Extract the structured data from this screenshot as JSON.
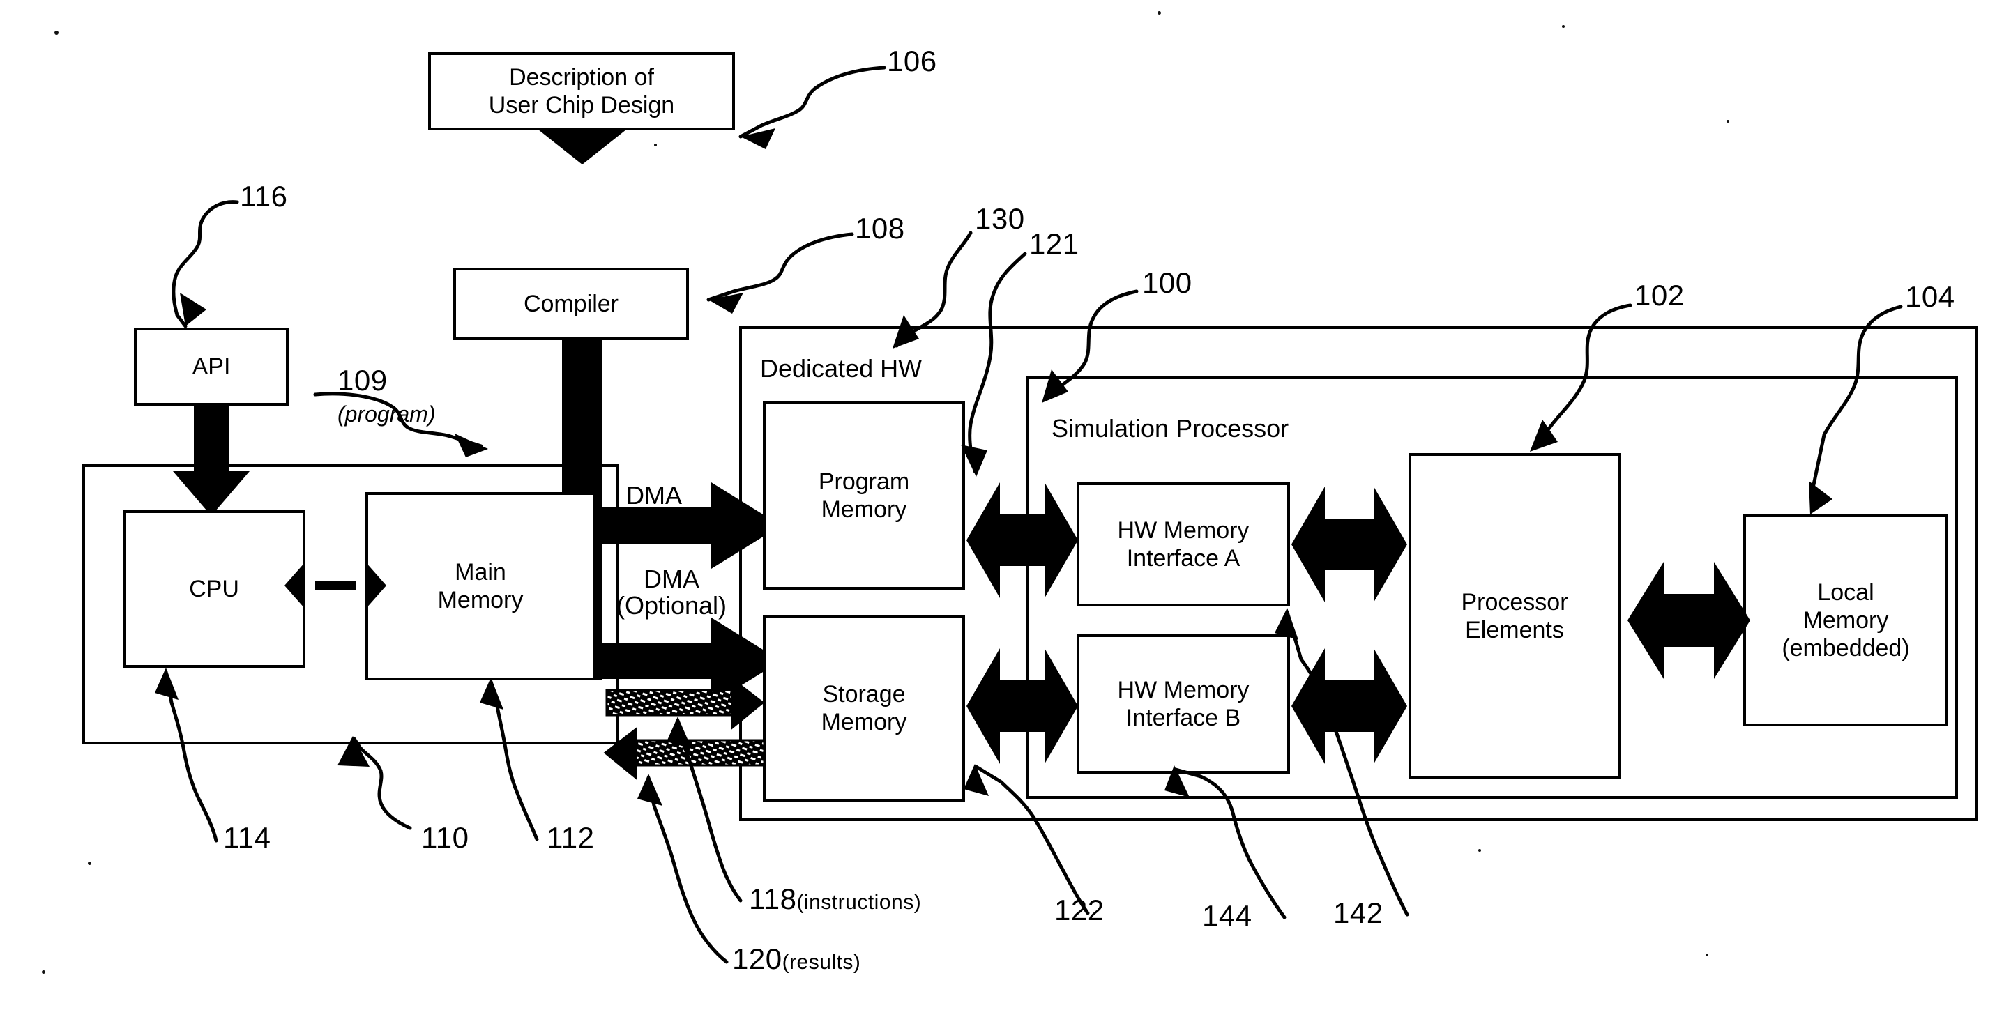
{
  "figure": {
    "title": "Simulation Processor System Block Diagram",
    "style": "patent-line-drawing",
    "ink_color": "#000000",
    "paper_color": "#ffffff"
  },
  "blocks": {
    "description": "Description of\nUser Chip Design",
    "description_line1": "Description of",
    "description_line2": "User Chip Design",
    "compiler": "Compiler",
    "api": "API",
    "cpu": "CPU",
    "main_memory_line1": "Main",
    "main_memory_line2": "Memory",
    "program_memory_line1": "Program",
    "program_memory_line2": "Memory",
    "storage_memory_line1": "Storage",
    "storage_memory_line2": "Memory",
    "hw_mem_a_line1": "HW Memory",
    "hw_mem_a_line2": "Interface A",
    "hw_mem_b_line1": "HW Memory",
    "hw_mem_b_line2": "Interface B",
    "processor_elements_line1": "Processor",
    "processor_elements_line2": "Elements",
    "local_memory_line1": "Local",
    "local_memory_line2": "Memory",
    "local_memory_line3": "(embedded)"
  },
  "containers": {
    "host_system": "",
    "dedicated_hw": "Dedicated HW",
    "simulation_processor": "Simulation Processor"
  },
  "flow_labels": {
    "dma": "DMA",
    "dma_optional_line1": "DMA",
    "dma_optional_line2": "(Optional)",
    "program_note": "(program)"
  },
  "reference_numerals": [
    {
      "id": "106",
      "number": "106",
      "suffix": "",
      "target": "description-of-user-chip-design"
    },
    {
      "id": "116",
      "number": "116",
      "suffix": "",
      "target": "api"
    },
    {
      "id": "108",
      "number": "108",
      "suffix": "",
      "target": "compiler"
    },
    {
      "id": "109",
      "number": "109",
      "suffix": "",
      "target": "program-arrow"
    },
    {
      "id": "130",
      "number": "130",
      "suffix": "",
      "target": "dedicated-hw-boundary"
    },
    {
      "id": "121",
      "number": "121",
      "suffix": "",
      "target": "program-memory"
    },
    {
      "id": "100",
      "number": "100",
      "suffix": "",
      "target": "simulation-processor"
    },
    {
      "id": "102",
      "number": "102",
      "suffix": "",
      "target": "processor-elements"
    },
    {
      "id": "104",
      "number": "104",
      "suffix": "",
      "target": "local-memory"
    },
    {
      "id": "114",
      "number": "114",
      "suffix": "",
      "target": "cpu"
    },
    {
      "id": "110",
      "number": "110",
      "suffix": "",
      "target": "host-system"
    },
    {
      "id": "112",
      "number": "112",
      "suffix": "",
      "target": "main-memory"
    },
    {
      "id": "118",
      "number": "118",
      "suffix": "(instructions)",
      "target": "instructions-arrow"
    },
    {
      "id": "120",
      "number": "120",
      "suffix": "(results)",
      "target": "results-arrow"
    },
    {
      "id": "122",
      "number": "122",
      "suffix": "",
      "target": "storage-memory"
    },
    {
      "id": "144",
      "number": "144",
      "suffix": "",
      "target": "hw-memory-interface-b"
    },
    {
      "id": "142",
      "number": "142",
      "suffix": "",
      "target": "hw-memory-interface-a"
    }
  ]
}
